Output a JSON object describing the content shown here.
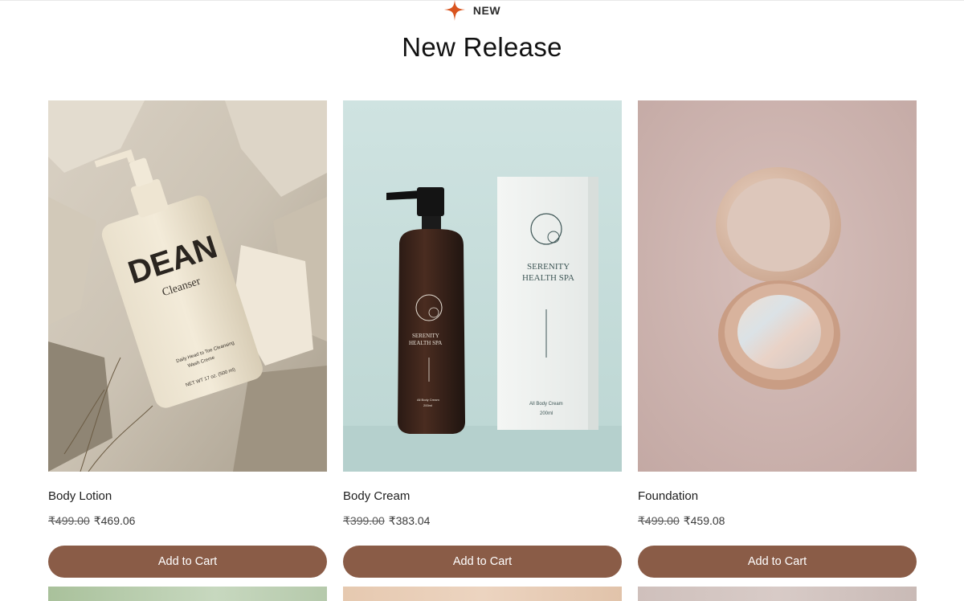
{
  "header": {
    "eyebrow": "NEW",
    "title": "New Release"
  },
  "colors": {
    "accent": "#8a5c47",
    "spark": "#d9541e"
  },
  "products": [
    {
      "name": "Body Lotion",
      "image_alt": "DEAN Cleanser",
      "price_old": "₹499.00",
      "price_new": "₹469.06",
      "button": "Add to Cart"
    },
    {
      "name": "Body Cream",
      "image_alt": "SERENITY HEALTH SPA",
      "price_old": "₹399.00",
      "price_new": "₹383.04",
      "button": "Add to Cart"
    },
    {
      "name": "Foundation",
      "image_alt": "",
      "price_old": "₹499.00",
      "price_new": "₹459.08",
      "button": "Add to Cart"
    }
  ],
  "product_art": {
    "dean_brand": "DEAN",
    "dean_sub": "Cleanser",
    "dean_line1": "Daily Head to Toe Cleansing",
    "dean_line2": "Wash Creme",
    "dean_net": "NET WT 17 oz. (500 ml)",
    "spa_name1": "SERENITY",
    "spa_name2": "HEALTH SPA",
    "spa_product": "All Body Cream",
    "spa_volume": "200ml"
  }
}
